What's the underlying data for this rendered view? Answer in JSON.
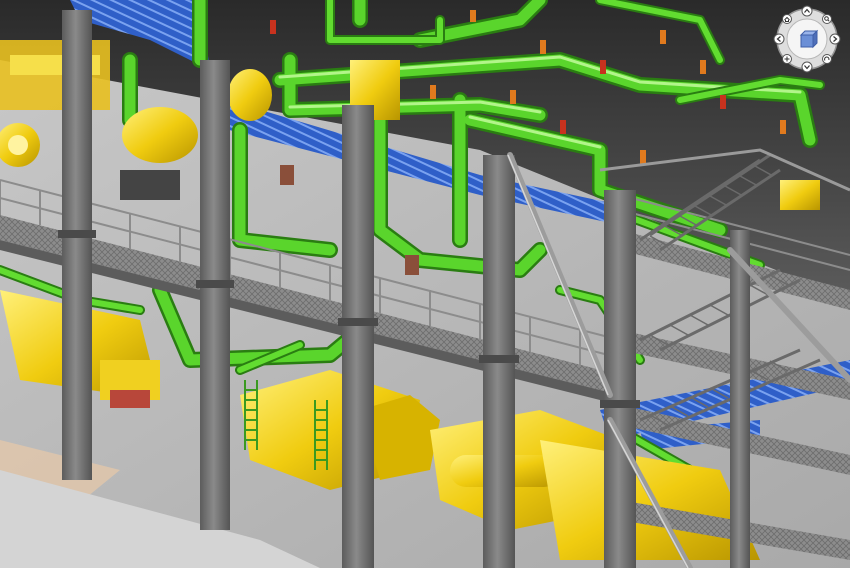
{
  "viewer": {
    "kind": "3d-plant-model-viewport",
    "background": "#3a3a3a",
    "floor_color": "#c9c9c9",
    "colors": {
      "steel_column": "#7b7b7b",
      "steel_column_dark": "#555555",
      "pipe_green": "#55d12c",
      "pipe_green_dark": "#2f8c16",
      "cable_tray_blue": "#3a6fd8",
      "equipment_yellow": "#f2d11a",
      "equipment_yellow_dark": "#b08f00",
      "valve_red": "#c8321e",
      "valve_orange": "#e07a1e",
      "handrail": "#9a9a9a"
    }
  },
  "navigation_cube": {
    "icon": "view-cube-icon",
    "controls": [
      {
        "name": "nav-orbit-up-icon"
      },
      {
        "name": "nav-orbit-down-icon"
      },
      {
        "name": "nav-orbit-left-icon"
      },
      {
        "name": "nav-orbit-right-icon"
      },
      {
        "name": "nav-home-icon"
      },
      {
        "name": "nav-zoom-icon"
      },
      {
        "name": "nav-pan-icon"
      },
      {
        "name": "nav-rotate-icon"
      }
    ]
  }
}
